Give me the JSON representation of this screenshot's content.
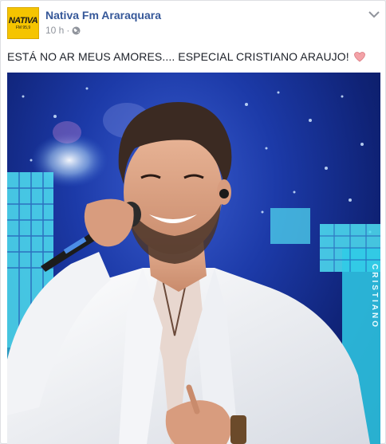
{
  "post": {
    "page_name": "Nativa Fm Araraquara",
    "timestamp": "10 h",
    "separator": "·",
    "privacy_icon": "globe-icon",
    "menu_icon": "chevron-down-icon",
    "text": "ESTÁ NO AR MEUS AMORES.... ESPECIAL CRISTIANO ARAUJO!",
    "emoji_icon": "heart-icon"
  },
  "avatar": {
    "logo_text": "NATIVA",
    "logo_subtext": "FM 95,9"
  },
  "photo": {
    "vertical_text": "CRISTIANO"
  },
  "colors": {
    "link": "#365899",
    "meta": "#90949c",
    "text": "#1d2129",
    "avatar_bg": "#f5c400",
    "heart": "#f3a2a7",
    "stage_blue": "#1c3aa8"
  }
}
